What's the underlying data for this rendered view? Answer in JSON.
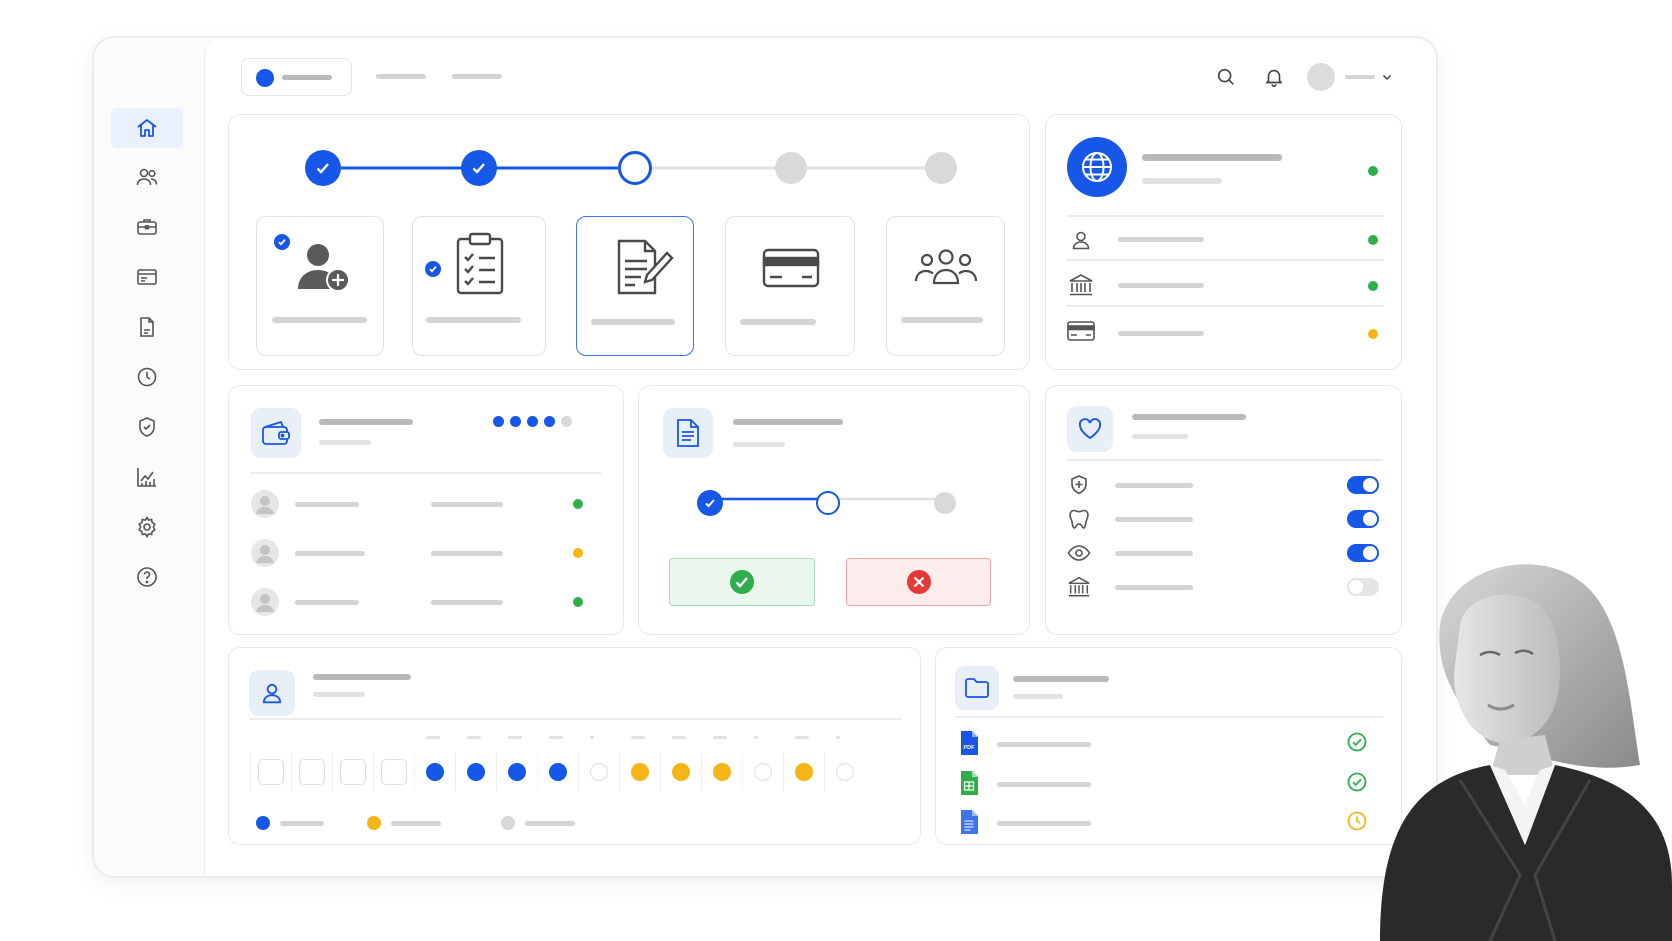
{
  "theme": {
    "accent": "#1657e8",
    "success": "#2fae4c",
    "warning": "#f6b516",
    "danger": "#e53935",
    "muted": "#d4d4d4"
  },
  "sidebar": {
    "items": [
      {
        "icon": "home-icon",
        "active": true
      },
      {
        "icon": "users-icon"
      },
      {
        "icon": "briefcase-icon"
      },
      {
        "icon": "card-list-icon"
      },
      {
        "icon": "document-icon"
      },
      {
        "icon": "clock-icon"
      },
      {
        "icon": "shield-check-icon"
      },
      {
        "icon": "chart-icon"
      },
      {
        "icon": "gear-icon"
      },
      {
        "icon": "help-icon"
      }
    ]
  },
  "onboarding": {
    "current_step": 3,
    "total_steps": 5,
    "steps": [
      {
        "icon": "add-user-icon",
        "state": "complete"
      },
      {
        "icon": "clipboard-checklist-icon",
        "state": "complete"
      },
      {
        "icon": "document-sign-icon",
        "state": "current"
      },
      {
        "icon": "credit-card-icon",
        "state": "pending"
      },
      {
        "icon": "group-icon",
        "state": "pending"
      }
    ]
  },
  "profile_card": {
    "icon": "globe-icon",
    "rows": [
      {
        "icon": "person-icon",
        "status": "success"
      },
      {
        "icon": "bank-icon",
        "status": "success"
      },
      {
        "icon": "credit-card-icon",
        "status": "warning"
      }
    ]
  },
  "wallet_card": {
    "icon": "wallet-icon",
    "progress_dots_filled": 4,
    "progress_dots_total": 5,
    "rows": [
      {
        "status": "success"
      },
      {
        "status": "warning"
      },
      {
        "status": "success"
      }
    ]
  },
  "approval_card": {
    "icon": "document-icon",
    "steps_completed": 1,
    "steps_total": 3,
    "approve_icon": "check-circle-icon",
    "reject_icon": "x-circle-icon"
  },
  "benefits_card": {
    "icon": "heart-icon",
    "toggles": [
      {
        "icon": "shield-plus-icon",
        "on": true
      },
      {
        "icon": "tooth-icon",
        "on": true
      },
      {
        "icon": "eye-icon",
        "on": true
      },
      {
        "icon": "bank-icon",
        "on": false
      }
    ]
  },
  "schedule_card": {
    "icon": "person-icon",
    "cells": [
      "empty-square",
      "empty-square",
      "empty-square",
      "empty-square",
      "blue",
      "blue",
      "blue",
      "blue",
      "empty",
      "orange",
      "orange",
      "orange",
      "empty",
      "orange",
      "empty"
    ],
    "legend": [
      {
        "color": "blue"
      },
      {
        "color": "orange"
      },
      {
        "color": "gray"
      }
    ]
  },
  "files_card": {
    "icon": "folder-icon",
    "files": [
      {
        "icon": "pdf-file-icon",
        "badge": "PDF",
        "status": "check-icon"
      },
      {
        "icon": "sheet-file-icon",
        "status": "check-icon"
      },
      {
        "icon": "doc-file-icon",
        "status": "pending-clock-icon"
      }
    ]
  }
}
